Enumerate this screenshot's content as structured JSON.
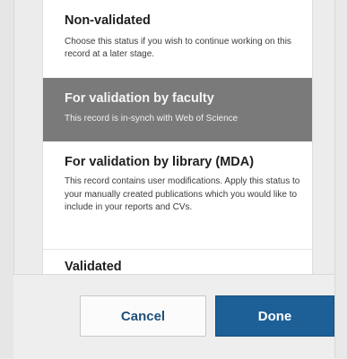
{
  "dialog": {
    "options": [
      {
        "title": "Non-validated",
        "description": "Choose this status if you wish to continue working on this record at a later stage."
      },
      {
        "title": "For validation by faculty",
        "description": "This record is in-synch with Web of Science"
      },
      {
        "title": "For validation by library (MDA)",
        "description": "This record contains user modifications. Apply this status to your manually created publications which you would like to include in your reports and CVs."
      },
      {
        "title": "Validated",
        "description": ""
      }
    ],
    "selected_index": 1
  },
  "buttons": {
    "cancel": "Cancel",
    "done": "Done"
  },
  "colors": {
    "selected_bg": "#7a7a7a",
    "primary": "#1d5f97",
    "cancel_text": "#1e4f7a"
  }
}
